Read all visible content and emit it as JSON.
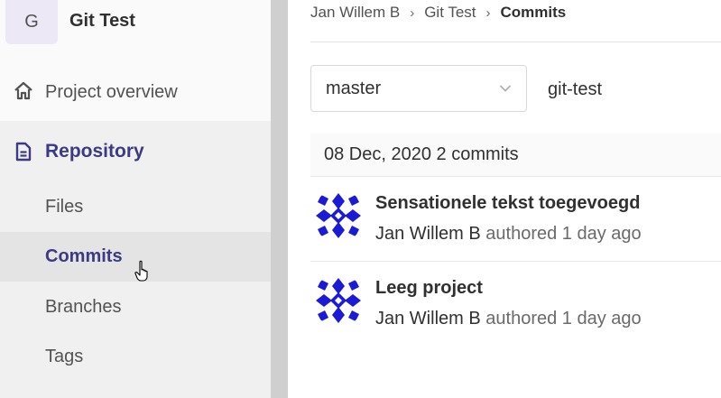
{
  "project": {
    "avatar_letter": "G",
    "name": "Git Test"
  },
  "sidebar": {
    "overview_label": "Project overview",
    "repository_label": "Repository",
    "sub_items": [
      {
        "label": "Files"
      },
      {
        "label": "Commits"
      },
      {
        "label": "Branches"
      },
      {
        "label": "Tags"
      }
    ]
  },
  "breadcrumb": {
    "items": [
      "Jan Willem B",
      "Git Test",
      "Commits"
    ]
  },
  "branch": {
    "selected": "master",
    "repo_path": "git-test"
  },
  "day_header": "08 Dec, 2020 2 commits",
  "commits": [
    {
      "title": "Sensationele tekst toegevoegd",
      "author": "Jan Willem B",
      "verb": "authored",
      "time": "1 day ago"
    },
    {
      "title": "Leeg project",
      "author": "Jan Willem B",
      "verb": "authored",
      "time": "1 day ago"
    }
  ],
  "colors": {
    "accent": "#3b3a82",
    "avatar_blue": "#1b1bd6"
  }
}
